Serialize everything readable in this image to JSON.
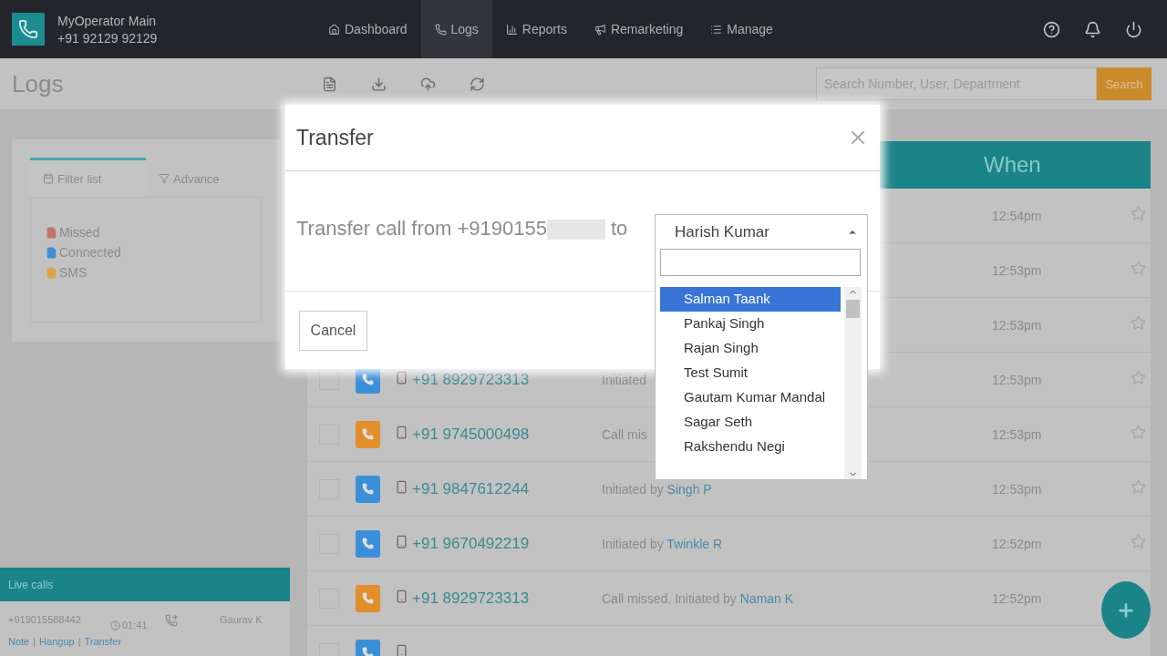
{
  "account": {
    "name": "MyOperator Main",
    "number": "+91 92129 92129"
  },
  "nav": [
    {
      "label": "Dashboard",
      "selected": false
    },
    {
      "label": "Logs",
      "selected": true
    },
    {
      "label": "Reports",
      "selected": false
    },
    {
      "label": "Remarketing",
      "selected": false
    },
    {
      "label": "Manage",
      "selected": false
    }
  ],
  "page_title": "Logs",
  "search": {
    "placeholder": "Search Number, User, Department",
    "button": "Search"
  },
  "filter": {
    "tabs": [
      {
        "label": "Filter list",
        "selected": true
      },
      {
        "label": "Advance",
        "selected": false
      }
    ],
    "legend": [
      {
        "label": "Missed",
        "color": "#c0746a"
      },
      {
        "label": "Connected",
        "color": "#3f8fd0"
      },
      {
        "label": "SMS",
        "color": "#e0a050"
      }
    ]
  },
  "live_calls": {
    "title": "Live calls",
    "number": "+919015588442",
    "duration": "01:41",
    "agent": "Gaurav K",
    "actions": [
      "Note",
      "Hangup",
      "Transfer"
    ],
    "separator": "|"
  },
  "table": {
    "columns": [
      "When"
    ],
    "rows": [
      {
        "time": "12:54pm"
      },
      {
        "time": "12:53pm"
      },
      {
        "time": "12:53pm"
      },
      {
        "kind": "connected",
        "checked": false,
        "number": "+91 8929723313",
        "description": "Initiated",
        "time": "12:53pm"
      },
      {
        "kind": "missed",
        "checked": false,
        "number": "+91 9745000498",
        "description": "Call mis",
        "time": "12:53pm"
      },
      {
        "kind": "connected",
        "checked": false,
        "number": "+91 9847612244",
        "description": "Initiated by",
        "agent": "Singh P",
        "time": "12:53pm"
      },
      {
        "kind": "connected",
        "checked": false,
        "number": "+91 9670492219",
        "description": "Initiated by",
        "agent": "Twinkle R",
        "time": "12:52pm"
      },
      {
        "kind": "missed",
        "checked": false,
        "number": "+91 8929723313",
        "description": "Call missed. Initiated by",
        "agent": "Naman K",
        "time": "12:52pm"
      },
      {
        "kind": "connected",
        "checked": false
      }
    ]
  },
  "dialog": {
    "title": "Transfer",
    "message": "Transfer call from +9190155",
    "message_end": "to",
    "select": {
      "value": "Harish Kumar",
      "options": [
        {
          "label": "Salman Taank",
          "selected": true
        },
        {
          "label": "Pankaj Singh",
          "selected": false
        },
        {
          "label": "Rajan Singh",
          "selected": false
        },
        {
          "label": "Test Sumit",
          "selected": false
        },
        {
          "label": "Gautam Kumar Mandal",
          "selected": false
        },
        {
          "label": "Sagar Seth",
          "selected": false
        },
        {
          "label": "Rakshendu Negi",
          "selected": false
        }
      ]
    },
    "cancel": "Cancel"
  }
}
